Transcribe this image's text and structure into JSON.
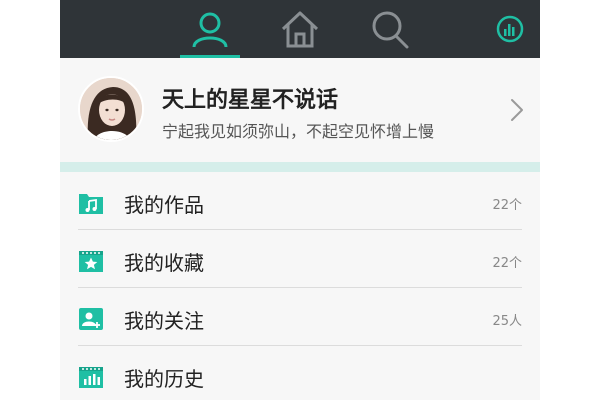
{
  "topbar": {
    "tabs": [
      {
        "icon": "person-icon",
        "active": true
      },
      {
        "icon": "home-icon",
        "active": false
      },
      {
        "icon": "search-icon",
        "active": false
      },
      {
        "icon": "stats-icon",
        "active": false
      }
    ],
    "accent_color": "#1fbfa4",
    "background_color": "#2f3438"
  },
  "profile": {
    "nickname": "天上的星星不说话",
    "signature": "宁起我见如须弥山，不起空见怀增上慢",
    "avatar_icon": "avatar"
  },
  "menu": {
    "items": [
      {
        "label": "我的作品",
        "count": "22个",
        "icon": "music-folder-icon"
      },
      {
        "label": "我的收藏",
        "count": "22个",
        "icon": "star-calendar-icon"
      },
      {
        "label": "我的关注",
        "count": "25人",
        "icon": "add-user-icon"
      },
      {
        "label": "我的历史",
        "count": "",
        "icon": "history-chart-icon"
      }
    ]
  }
}
